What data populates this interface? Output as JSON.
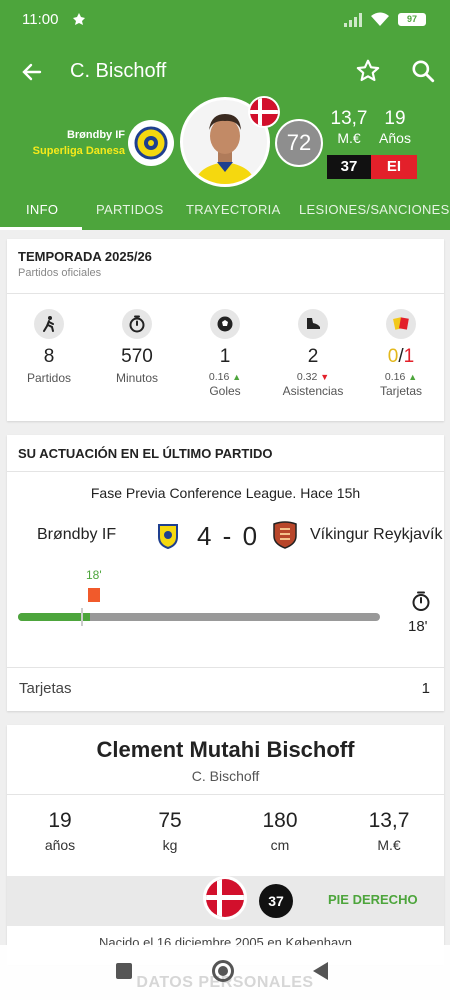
{
  "status_bar": {
    "time": "11:00",
    "battery": "97"
  },
  "header": {
    "title": "C. Bischoff",
    "club": "Brøndby IF",
    "league": "Superliga Danesa",
    "rating": "72",
    "market_value": "13,7",
    "market_value_unit": "M.€",
    "age": "19",
    "age_unit": "Años",
    "shirt_number": "37",
    "position": "EI",
    "colors": {
      "green": "#4da53c",
      "league_yellow": "#f7ea1a",
      "position_red": "#e3202a"
    }
  },
  "tabs": [
    {
      "label": "INFO",
      "active": true
    },
    {
      "label": "PARTIDOS"
    },
    {
      "label": "TRAYECTORIA"
    },
    {
      "label": "LESIONES/SANCIONES"
    }
  ],
  "season": {
    "title": "TEMPORADA 2025/26",
    "subtitle": "Partidos oficiales",
    "stats": [
      {
        "icon": "player-icon",
        "value": "8",
        "label": "Partidos"
      },
      {
        "icon": "stopwatch-icon",
        "value": "570",
        "label": "Minutos"
      },
      {
        "icon": "ball-icon",
        "value": "1",
        "per_game": "0.16",
        "trend": "up",
        "label": "Goles"
      },
      {
        "icon": "boot-icon",
        "value": "2",
        "per_game": "0.32",
        "trend": "down",
        "label": "Asistencias"
      },
      {
        "icon": "cards-icon",
        "yellow": "0",
        "red": "1",
        "per_game": "0.16",
        "trend": "up",
        "label": "Tarjetas"
      }
    ]
  },
  "last_match": {
    "title": "SU ACTUACIÓN EN EL ÚLTIMO PARTIDO",
    "competition": "Fase Previa Conference League. Hace 15h",
    "home_team": "Brøndby IF",
    "away_team": "Víkingur Reykjavík",
    "score": "4 - 0",
    "sub_minute": "18'",
    "minutes_played": "18'",
    "played_fraction": 0.2,
    "cards_label": "Tarjetas",
    "cards_value": "1"
  },
  "profile": {
    "full_name": "Clement Mutahi Bischoff",
    "short_name": "C. Bischoff",
    "stats": [
      {
        "value": "19",
        "label": "años"
      },
      {
        "value": "75",
        "label": "kg"
      },
      {
        "value": "180",
        "label": "cm"
      },
      {
        "value": "13,7",
        "label": "M.€"
      }
    ],
    "shirt_number": "37",
    "foot": "PIE DERECHO",
    "born": "Nacido el 16 diciembre 2005 en København"
  },
  "bottom": {
    "ghost_label": "DATOS PERSONALES"
  }
}
